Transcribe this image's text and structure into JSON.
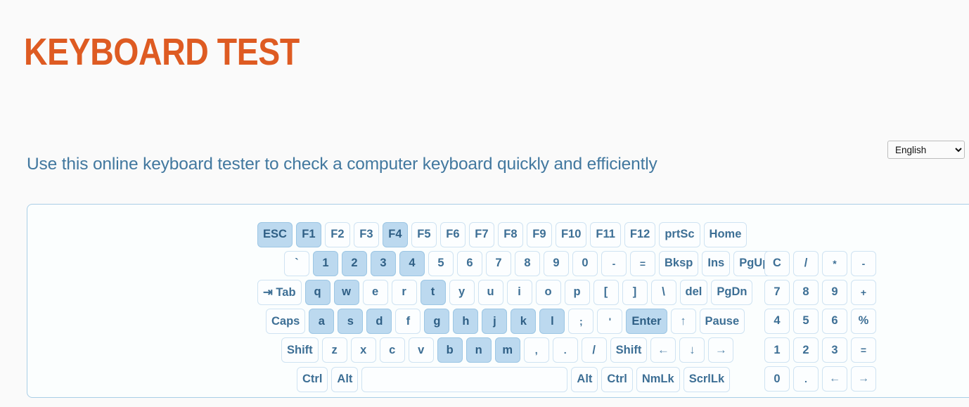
{
  "header": {
    "title": "KEYBOARD TEST",
    "title_color": "#de5b22"
  },
  "subtitle": "Use this online keyboard tester to check a computer keyboard quickly and efficiently",
  "language_select": {
    "selected": "English",
    "options": [
      "English"
    ]
  },
  "theme": {
    "background": "#fafafa",
    "panel_background": "#fbfefe",
    "panel_border": "#a9cee6",
    "key_background": "#fcfeff",
    "key_border": "#cfe3f2",
    "key_text": "#3d6f95",
    "key_active_background": "#bcd9ef",
    "key_active_border": "#9cc6e4",
    "subtitle_color": "#42789f"
  },
  "keyboard": {
    "rows": [
      {
        "name": "function-row",
        "indent": 1,
        "keys": [
          {
            "label": "ESC",
            "name": "key-esc",
            "active": true
          },
          {
            "label": "F1",
            "name": "key-f1",
            "active": true
          },
          {
            "label": "F2",
            "name": "key-f2",
            "active": false
          },
          {
            "label": "F3",
            "name": "key-f3",
            "active": false
          },
          {
            "label": "F4",
            "name": "key-f4",
            "active": true
          },
          {
            "label": "F5",
            "name": "key-f5",
            "active": false
          },
          {
            "label": "F6",
            "name": "key-f6",
            "active": false
          },
          {
            "label": "F7",
            "name": "key-f7",
            "active": false
          },
          {
            "label": "F8",
            "name": "key-f8",
            "active": false
          },
          {
            "label": "F9",
            "name": "key-f9",
            "active": false
          },
          {
            "label": "F10",
            "name": "key-f10",
            "active": false
          },
          {
            "label": "F11",
            "name": "key-f11",
            "active": false
          },
          {
            "label": "F12",
            "name": "key-f12",
            "active": false
          },
          {
            "label": "prtSc",
            "name": "key-prtsc",
            "active": false
          },
          {
            "label": "Home",
            "name": "key-home",
            "active": false
          }
        ]
      },
      {
        "name": "number-row",
        "indent": 2,
        "keys": [
          {
            "label": "`",
            "name": "key-backtick",
            "active": false
          },
          {
            "label": "1",
            "name": "key-1",
            "active": true
          },
          {
            "label": "2",
            "name": "key-2",
            "active": true
          },
          {
            "label": "3",
            "name": "key-3",
            "active": true
          },
          {
            "label": "4",
            "name": "key-4",
            "active": true
          },
          {
            "label": "5",
            "name": "key-5",
            "active": false
          },
          {
            "label": "6",
            "name": "key-6",
            "active": false
          },
          {
            "label": "7",
            "name": "key-7",
            "active": false
          },
          {
            "label": "8",
            "name": "key-8",
            "active": false
          },
          {
            "label": "9",
            "name": "key-9",
            "active": false
          },
          {
            "label": "0",
            "name": "key-0",
            "active": false
          },
          {
            "label": "-",
            "name": "key-minus",
            "active": false,
            "small": true
          },
          {
            "label": "=",
            "name": "key-equals",
            "active": false,
            "small": true
          },
          {
            "label": "Bksp",
            "name": "key-backspace",
            "active": false
          },
          {
            "label": "Ins",
            "name": "key-insert",
            "active": false
          },
          {
            "label": "PgUp",
            "name": "key-pageup",
            "active": false
          }
        ]
      },
      {
        "name": "qwerty-row",
        "indent": 3,
        "keys": [
          {
            "label": "⇥ Tab",
            "name": "key-tab",
            "active": false
          },
          {
            "label": "q",
            "name": "key-q",
            "active": true
          },
          {
            "label": "w",
            "name": "key-w",
            "active": true
          },
          {
            "label": "e",
            "name": "key-e",
            "active": false
          },
          {
            "label": "r",
            "name": "key-r",
            "active": false
          },
          {
            "label": "t",
            "name": "key-t",
            "active": true
          },
          {
            "label": "y",
            "name": "key-y",
            "active": false
          },
          {
            "label": "u",
            "name": "key-u",
            "active": false
          },
          {
            "label": "i",
            "name": "key-i",
            "active": false
          },
          {
            "label": "o",
            "name": "key-o",
            "active": false
          },
          {
            "label": "p",
            "name": "key-p",
            "active": false
          },
          {
            "label": "[",
            "name": "key-bracket-left",
            "active": false
          },
          {
            "label": "]",
            "name": "key-bracket-right",
            "active": false
          },
          {
            "label": "\\",
            "name": "key-backslash",
            "active": false
          },
          {
            "label": "del",
            "name": "key-delete",
            "active": false
          },
          {
            "label": "PgDn",
            "name": "key-pagedown",
            "active": false
          }
        ]
      },
      {
        "name": "home-row",
        "indent": 4,
        "keys": [
          {
            "label": "Caps",
            "name": "key-capslock",
            "active": false
          },
          {
            "label": "a",
            "name": "key-a",
            "active": true
          },
          {
            "label": "s",
            "name": "key-s",
            "active": true
          },
          {
            "label": "d",
            "name": "key-d",
            "active": true
          },
          {
            "label": "f",
            "name": "key-f",
            "active": false
          },
          {
            "label": "g",
            "name": "key-g",
            "active": true
          },
          {
            "label": "h",
            "name": "key-h",
            "active": true
          },
          {
            "label": "j",
            "name": "key-j",
            "active": true
          },
          {
            "label": "k",
            "name": "key-k",
            "active": true
          },
          {
            "label": "l",
            "name": "key-l",
            "active": true
          },
          {
            "label": ";",
            "name": "key-semicolon",
            "active": false,
            "small": true
          },
          {
            "label": "'",
            "name": "key-quote",
            "active": false,
            "small": true
          },
          {
            "label": "Enter",
            "name": "key-enter",
            "active": true
          },
          {
            "label": "↑",
            "name": "key-arrow-up",
            "active": false,
            "arrow": true
          },
          {
            "label": "Pause",
            "name": "key-pause",
            "active": false
          }
        ]
      },
      {
        "name": "shift-row",
        "indent": 5,
        "keys": [
          {
            "label": "Shift",
            "name": "key-shift-left",
            "active": false
          },
          {
            "label": "z",
            "name": "key-z",
            "active": false
          },
          {
            "label": "x",
            "name": "key-x",
            "active": false
          },
          {
            "label": "c",
            "name": "key-c",
            "active": false
          },
          {
            "label": "v",
            "name": "key-v",
            "active": false
          },
          {
            "label": "b",
            "name": "key-b",
            "active": true
          },
          {
            "label": "n",
            "name": "key-n",
            "active": true
          },
          {
            "label": "m",
            "name": "key-m",
            "active": true
          },
          {
            "label": ",",
            "name": "key-comma",
            "active": false,
            "small": true
          },
          {
            "label": ".",
            "name": "key-period",
            "active": false,
            "small": true
          },
          {
            "label": "/",
            "name": "key-slash",
            "active": false
          },
          {
            "label": "Shift",
            "name": "key-shift-right",
            "active": false
          },
          {
            "label": "←",
            "name": "key-arrow-left",
            "active": false,
            "arrow": true
          },
          {
            "label": "↓",
            "name": "key-arrow-down",
            "active": false,
            "arrow": true
          },
          {
            "label": "→",
            "name": "key-arrow-right",
            "active": false,
            "arrow": true
          }
        ]
      },
      {
        "name": "bottom-row",
        "indent": 6,
        "keys": [
          {
            "label": "Ctrl",
            "name": "key-ctrl-left",
            "active": false
          },
          {
            "label": "Alt",
            "name": "key-alt-left",
            "active": false
          },
          {
            "label": "",
            "name": "key-space",
            "active": false,
            "space": true
          },
          {
            "label": "Alt",
            "name": "key-alt-right",
            "active": false
          },
          {
            "label": "Ctrl",
            "name": "key-ctrl-right",
            "active": false
          },
          {
            "label": "NmLk",
            "name": "key-numlock",
            "active": false
          },
          {
            "label": "ScrlLk",
            "name": "key-scrolllock",
            "active": false
          }
        ]
      }
    ],
    "numpad_rows": [
      {
        "name": "numpad-row-1",
        "keys": [
          {
            "label": "C",
            "name": "numpad-key-clear",
            "active": false
          },
          {
            "label": "/",
            "name": "numpad-key-divide",
            "active": false
          },
          {
            "label": "*",
            "name": "numpad-key-multiply",
            "active": false,
            "small": true
          },
          {
            "label": "-",
            "name": "numpad-key-subtract",
            "active": false,
            "small": true
          }
        ]
      },
      {
        "name": "numpad-row-2",
        "keys": [
          {
            "label": "7",
            "name": "numpad-key-7",
            "active": false
          },
          {
            "label": "8",
            "name": "numpad-key-8",
            "active": false
          },
          {
            "label": "9",
            "name": "numpad-key-9",
            "active": false
          },
          {
            "label": "+",
            "name": "numpad-key-add",
            "active": false,
            "small": true
          }
        ]
      },
      {
        "name": "numpad-row-3",
        "keys": [
          {
            "label": "4",
            "name": "numpad-key-4",
            "active": false
          },
          {
            "label": "5",
            "name": "numpad-key-5",
            "active": false
          },
          {
            "label": "6",
            "name": "numpad-key-6",
            "active": false
          },
          {
            "label": "%",
            "name": "numpad-key-percent",
            "active": false
          }
        ]
      },
      {
        "name": "numpad-row-4",
        "keys": [
          {
            "label": "1",
            "name": "numpad-key-1",
            "active": false
          },
          {
            "label": "2",
            "name": "numpad-key-2",
            "active": false
          },
          {
            "label": "3",
            "name": "numpad-key-3",
            "active": false
          },
          {
            "label": "=",
            "name": "numpad-key-equals",
            "active": false,
            "small": true
          }
        ]
      },
      {
        "name": "numpad-row-5",
        "keys": [
          {
            "label": "0",
            "name": "numpad-key-0",
            "active": false
          },
          {
            "label": ".",
            "name": "numpad-key-decimal",
            "active": false,
            "small": true
          },
          {
            "label": "←",
            "name": "numpad-key-arrow-left",
            "active": false,
            "arrow": true
          },
          {
            "label": "→",
            "name": "numpad-key-arrow-right",
            "active": false,
            "arrow": true
          }
        ]
      }
    ]
  }
}
